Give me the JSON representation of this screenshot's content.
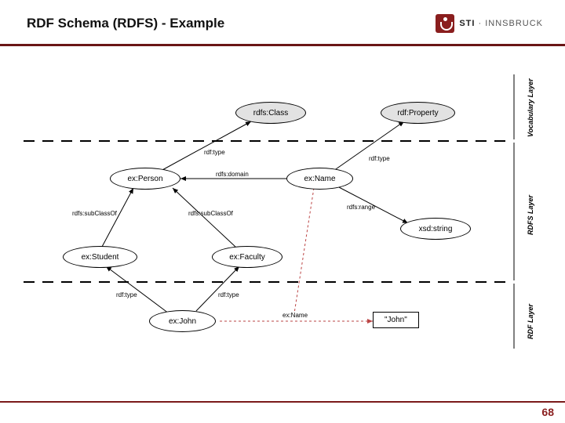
{
  "title": "RDF Schema (RDFS) - Example",
  "logo": {
    "bold": "STI",
    "rest": " · INNSBRUCK"
  },
  "page_number": "68",
  "layers": {
    "vocab": "Vocabulary Layer",
    "rdfs": "RDFS Layer",
    "rdf": "RDF Layer"
  },
  "nodes": {
    "rdfs_class": "rdfs:Class",
    "rdf_property": "rdf:Property",
    "ex_person": "ex:Person",
    "ex_name": "ex:Name",
    "xsd_string": "xsd:string",
    "ex_student": "ex:Student",
    "ex_faculty": "ex:Faculty",
    "ex_john": "ex:John",
    "john_literal": "\"John\""
  },
  "edges": {
    "rdf_type": "rdf:type",
    "rdfs_domain": "rdfs:domain",
    "rdfs_range": "rdfs:range",
    "rdfs_subclass": "rdfs:subClassOf",
    "ex_name": "ex:Name"
  }
}
